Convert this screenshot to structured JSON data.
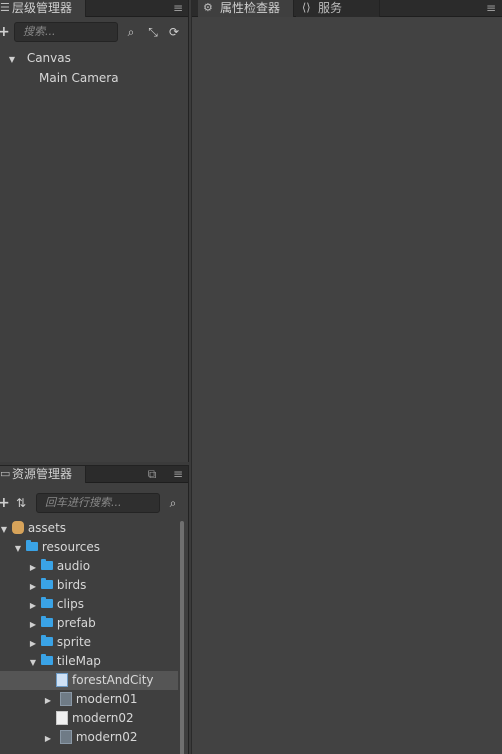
{
  "hierarchy": {
    "tab_label": "层级管理器",
    "search_placeholder": "搜索...",
    "nodes": [
      {
        "label": "Canvas",
        "expanded": true
      },
      {
        "label": "Main Camera"
      }
    ]
  },
  "inspector": {
    "tabs": [
      {
        "label": "属性检查器",
        "active": true
      },
      {
        "label": "服务",
        "active": false
      }
    ]
  },
  "assets": {
    "tab_label": "资源管理器",
    "search_placeholder": "回车进行搜索...",
    "tree": [
      {
        "label": "assets",
        "type": "db",
        "expanded": true
      },
      {
        "label": "resources",
        "type": "folder",
        "expanded": true
      },
      {
        "label": "audio",
        "type": "folder"
      },
      {
        "label": "birds",
        "type": "folder"
      },
      {
        "label": "clips",
        "type": "folder"
      },
      {
        "label": "prefab",
        "type": "folder"
      },
      {
        "label": "sprite",
        "type": "folder"
      },
      {
        "label": "tileMap",
        "type": "folder",
        "expanded": true
      },
      {
        "label": "forestAndCity",
        "type": "tilemap",
        "selected": true
      },
      {
        "label": "modern01",
        "type": "image"
      },
      {
        "label": "modern02",
        "type": "doc"
      },
      {
        "label": "modern02",
        "type": "image"
      }
    ]
  },
  "colors": {
    "folder": "#3aa3e6",
    "panel_bg": "#3f3f3f",
    "tab_bar_bg": "#2b2b2b",
    "selected_row": "#555555"
  }
}
